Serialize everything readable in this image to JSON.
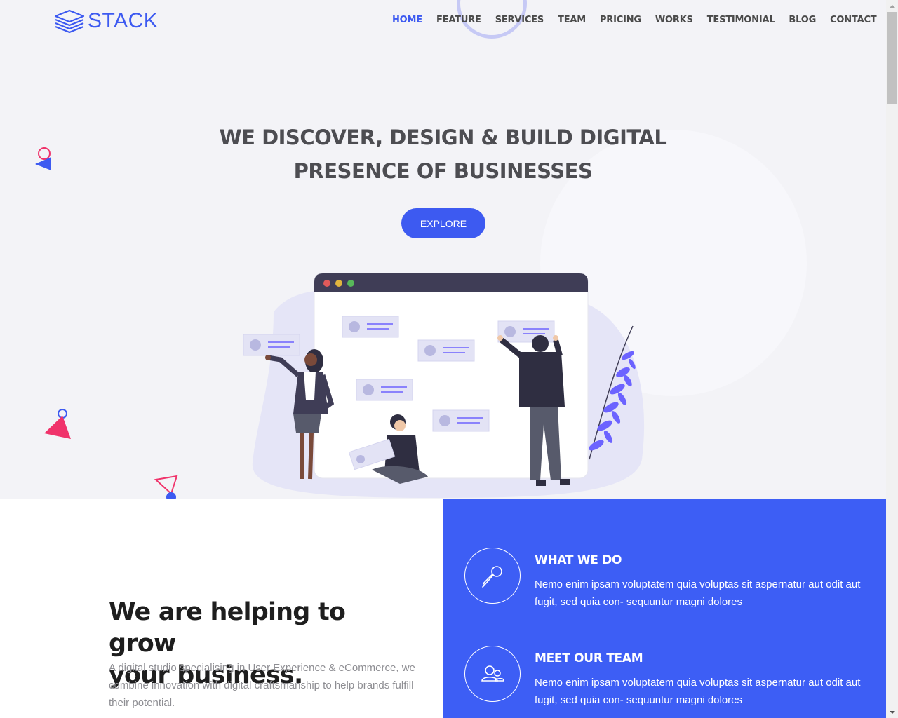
{
  "brand": {
    "name": "STACK",
    "accent": "#3d5af1",
    "icon": "stack-layers-icon"
  },
  "nav": {
    "items": [
      {
        "label": "HOME",
        "active": true
      },
      {
        "label": "FEATURE",
        "active": false
      },
      {
        "label": "SERVICES",
        "active": false
      },
      {
        "label": "TEAM",
        "active": false
      },
      {
        "label": "PRICING",
        "active": false
      },
      {
        "label": "WORKS",
        "active": false
      },
      {
        "label": "TESTIMONIAL",
        "active": false
      },
      {
        "label": "BLOG",
        "active": false
      },
      {
        "label": "CONTACT",
        "active": false
      }
    ]
  },
  "hero": {
    "title_line1": "WE DISCOVER, DESIGN & BUILD DIGITAL",
    "title_line2": "PRESENCE OF BUSINESSES",
    "cta_label": "EXPLORE",
    "illustration": "team-collaborating-browser-illustration"
  },
  "about": {
    "title_line1": "We are helping to grow",
    "title_line2": "your business.",
    "text": "A digital studio specialising in User Experience & eCommerce, we combine innovation with digital craftsmanship to help brands fulfill their potential."
  },
  "features": [
    {
      "icon": "microphone-icon",
      "title": "WHAT WE DO",
      "text": "Nemo enim ipsam voluptatem quia voluptas sit aspernatur aut odit aut fugit, sed quia con- sequuntur magni dolores"
    },
    {
      "icon": "users-icon",
      "title": "MEET OUR TEAM",
      "text": "Nemo enim ipsam voluptatem quia voluptas sit aspernatur aut odit aut fugit, sed quia con- sequuntur magni dolores"
    }
  ],
  "colors": {
    "primary": "#3d5af1",
    "feature_bg": "#3d5ef5",
    "pink": "#f0336b",
    "hero_bg": "#f3f3f7"
  }
}
